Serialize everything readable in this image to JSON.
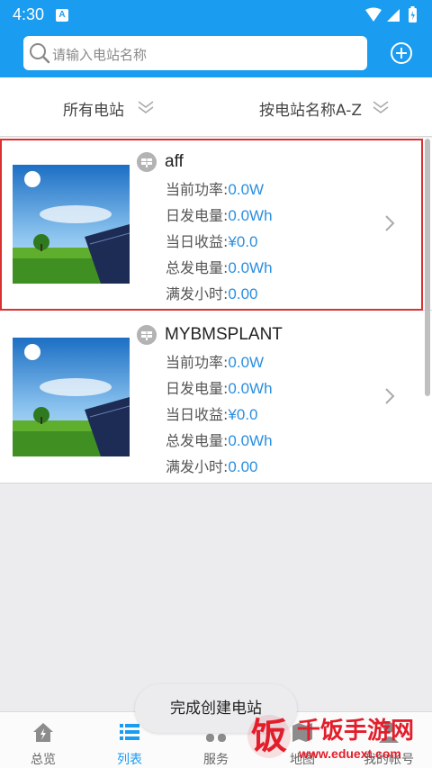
{
  "status_bar": {
    "time": "4:30",
    "notification_icon": "A"
  },
  "search": {
    "placeholder": "请输入电站名称"
  },
  "filters": {
    "scope": "所有电站",
    "sort": "按电站名称A-Z"
  },
  "stations": [
    {
      "name": "aff",
      "selected": true,
      "fields": [
        {
          "label": "当前功率:",
          "value": "0.0W"
        },
        {
          "label": "日发电量:",
          "value": "0.0Wh"
        },
        {
          "label": "当日收益:",
          "value": "¥0.0"
        },
        {
          "label": "总发电量:",
          "value": "0.0Wh"
        },
        {
          "label": "满发小时:",
          "value": "0.00"
        }
      ]
    },
    {
      "name": "MYBMSPLANT",
      "selected": false,
      "fields": [
        {
          "label": "当前功率:",
          "value": "0.0W"
        },
        {
          "label": "日发电量:",
          "value": "0.0Wh"
        },
        {
          "label": "当日收益:",
          "value": "¥0.0"
        },
        {
          "label": "总发电量:",
          "value": "0.0Wh"
        },
        {
          "label": "满发小时:",
          "value": "0.00"
        }
      ]
    }
  ],
  "toast": "完成创建电站",
  "tabs": [
    {
      "label": "总览",
      "icon": "home-icon",
      "active": false
    },
    {
      "label": "列表",
      "icon": "list-icon",
      "active": true
    },
    {
      "label": "服务",
      "icon": "service-icon",
      "active": false
    },
    {
      "label": "地图",
      "icon": "map-icon",
      "active": false
    },
    {
      "label": "我的帐号",
      "icon": "account-icon",
      "active": false
    }
  ],
  "watermark": {
    "title": "千饭手游网",
    "url": "www.eduext.com",
    "logo_glyph": "饭"
  },
  "colors": {
    "brand_blue": "#1a9cf0",
    "value_blue": "#2b8fe0",
    "selection_red": "#d93030",
    "watermark_red": "#e21e2b"
  }
}
